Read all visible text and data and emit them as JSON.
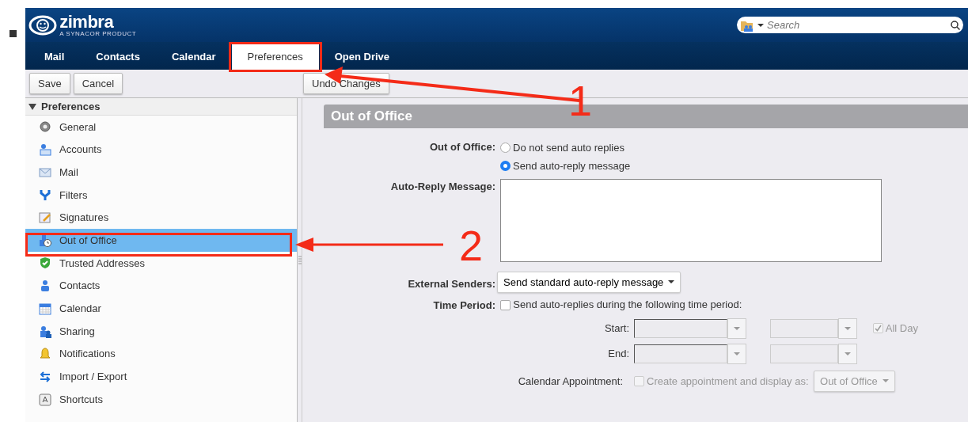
{
  "header": {
    "logo": "zimbra",
    "tagline": "A SYNACOR PRODUCT",
    "search": {
      "placeholder": "Search"
    }
  },
  "tabs": [
    {
      "label": "Mail",
      "selected": false
    },
    {
      "label": "Contacts",
      "selected": false
    },
    {
      "label": "Calendar",
      "selected": false
    },
    {
      "label": "Preferences",
      "selected": true
    },
    {
      "label": "Open Drive",
      "selected": false
    }
  ],
  "toolbar": {
    "left_buttons": [
      "Save",
      "Cancel"
    ],
    "right_buttons": [
      "Undo Changes"
    ]
  },
  "sidebar": {
    "heading": "Preferences",
    "expanded": true,
    "items": [
      {
        "label": "General",
        "selected": false
      },
      {
        "label": "Accounts",
        "selected": false
      },
      {
        "label": "Mail",
        "selected": false
      },
      {
        "label": "Filters",
        "selected": false
      },
      {
        "label": "Signatures",
        "selected": false
      },
      {
        "label": "Out of Office",
        "selected": true
      },
      {
        "label": "Trusted Addresses",
        "selected": false
      },
      {
        "label": "Contacts",
        "selected": false
      },
      {
        "label": "Calendar",
        "selected": false
      },
      {
        "label": "Sharing",
        "selected": false
      },
      {
        "label": "Notifications",
        "selected": false
      },
      {
        "label": "Import / Export",
        "selected": false
      },
      {
        "label": "Shortcuts",
        "selected": false
      }
    ]
  },
  "panel": {
    "title": "Out of Office",
    "out_of_office": {
      "label": "Out of Office:",
      "options": [
        {
          "label": "Do not send auto replies",
          "selected": false
        },
        {
          "label": "Send auto-reply message",
          "selected": true
        }
      ]
    },
    "message": {
      "label": "Auto-Reply Message:"
    },
    "external_senders": {
      "label": "External Senders:",
      "value": "Send standard auto-reply message"
    },
    "time_period": {
      "label": "Time Period:",
      "checkbox": {
        "label": "Send auto-replies during the following time period:",
        "checked": false
      },
      "start_label": "Start:",
      "end_label": "End:",
      "all_day": {
        "label": "All Day",
        "checked": true,
        "disabled": true
      }
    },
    "calendar_appointment": {
      "label": "Calendar Appointment:",
      "checkbox": {
        "label": "Create appointment and display as:",
        "checked": false,
        "disabled": true
      },
      "value": "Out of Office",
      "disabled": true
    }
  },
  "annotations": [
    {
      "number": "1"
    },
    {
      "number": "2"
    }
  ]
}
